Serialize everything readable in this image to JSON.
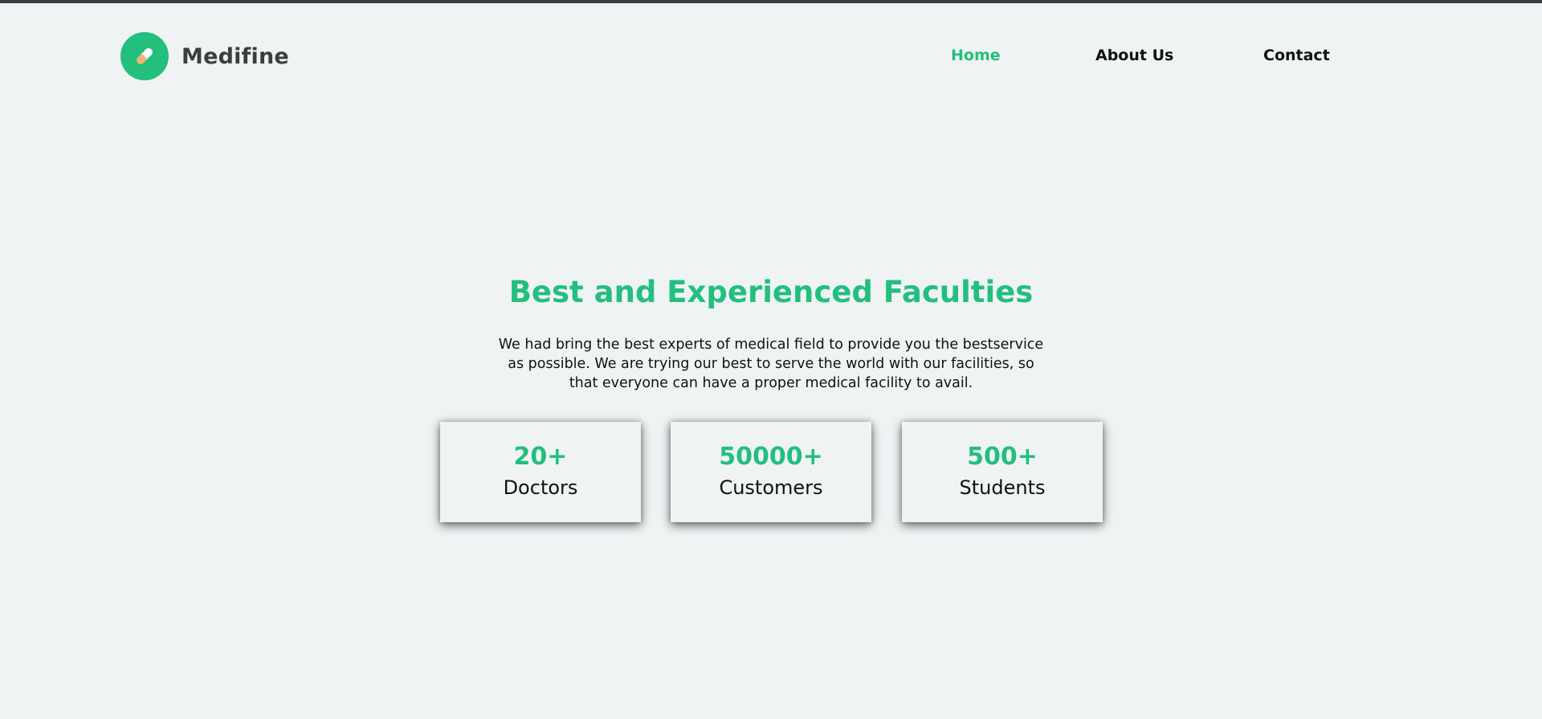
{
  "brand": {
    "name": "Medifine",
    "logo_icon": "pill-icon",
    "accent_color": "#22bf7d"
  },
  "nav": {
    "items": [
      {
        "label": "Home",
        "active": true
      },
      {
        "label": "About Us",
        "active": false
      },
      {
        "label": "Contact",
        "active": false
      }
    ]
  },
  "hero": {
    "title": "Best and Experienced Faculties",
    "description": "We had bring the best experts of medical field to provide you the bestservice as possible. We are trying our best to serve the world with our facilities, so that everyone can have a proper medical facility to avail."
  },
  "stats": [
    {
      "value": "20+",
      "label": "Doctors"
    },
    {
      "value": "50000+",
      "label": "Customers"
    },
    {
      "value": "500+",
      "label": "Students"
    }
  ]
}
